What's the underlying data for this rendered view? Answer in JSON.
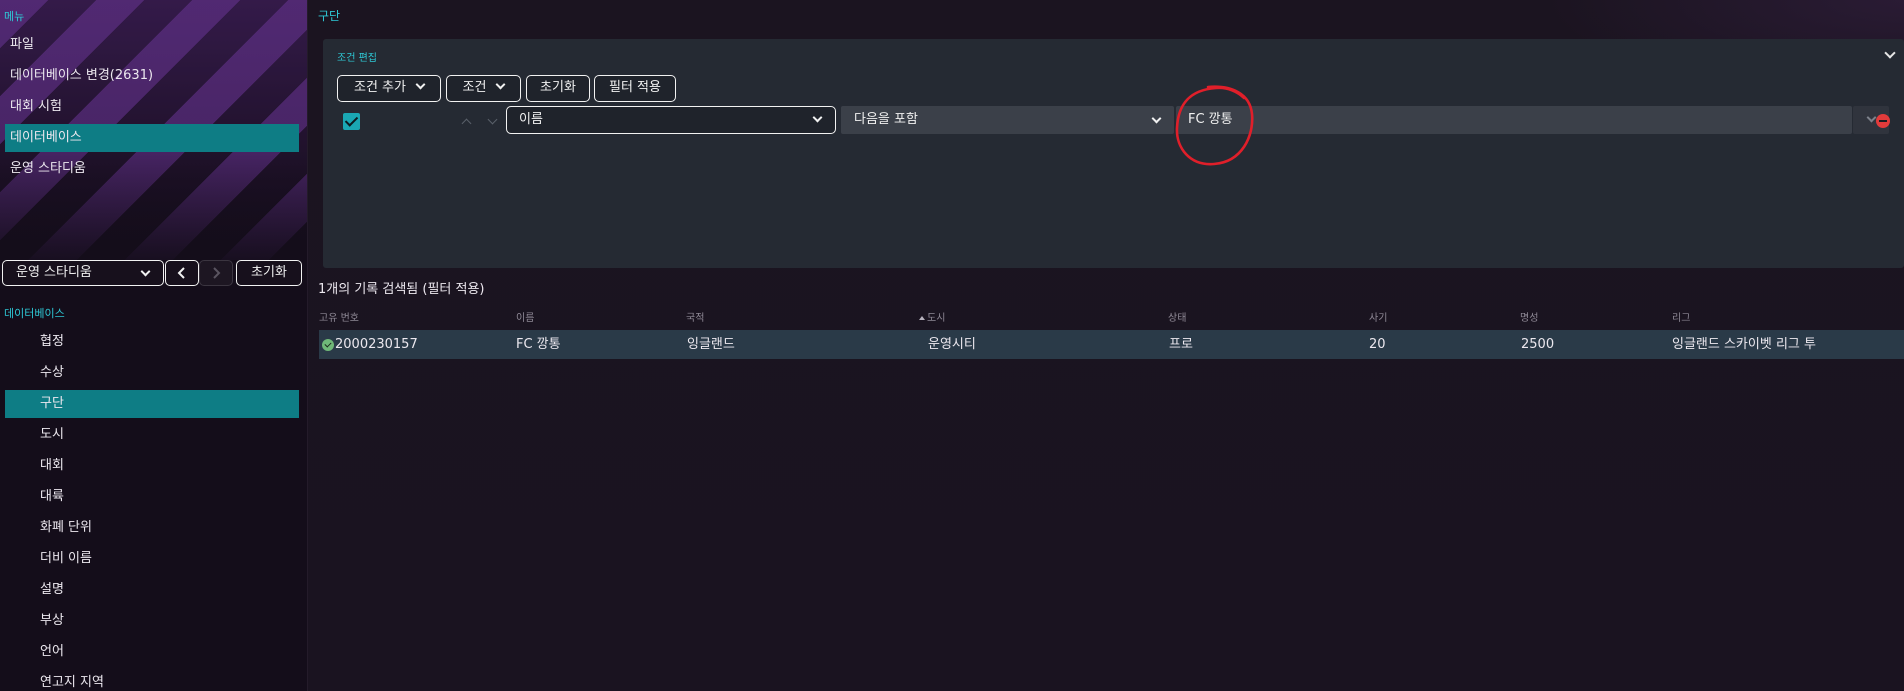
{
  "sidebar": {
    "menu_label": "메뉴",
    "menu_items": [
      {
        "label": "파일"
      },
      {
        "label": "데이터베이스 변경(2631)"
      },
      {
        "label": "대회 시험"
      },
      {
        "label": "데이터베이스",
        "active": true
      },
      {
        "label": "운영 스타디움"
      }
    ],
    "stadium_select": {
      "value": "운영 스타디움"
    },
    "reset_label": "초기화",
    "db_label": "데이터베이스",
    "db_items": [
      {
        "label": "협정"
      },
      {
        "label": "수상"
      },
      {
        "label": "구단",
        "active": true
      },
      {
        "label": "도시"
      },
      {
        "label": "대회"
      },
      {
        "label": "대륙"
      },
      {
        "label": "화폐 단위"
      },
      {
        "label": "더비 이름"
      },
      {
        "label": "설명"
      },
      {
        "label": "부상"
      },
      {
        "label": "언어"
      },
      {
        "label": "연고지 지역"
      }
    ]
  },
  "main": {
    "title": "구단",
    "filter_panel": {
      "title": "조건 편집",
      "add_condition_label": "조건 추가",
      "condition_label": "조건",
      "reset_label": "초기화",
      "apply_filter_label": "필터 적용",
      "condition_row": {
        "checked": true,
        "field": "이름",
        "operator": "다음을 포함",
        "value": "FC 깡통"
      }
    },
    "results": {
      "count_text": "1개의 기록 검색됨 (필터 적용)",
      "columns": [
        "고유 번호",
        "이름",
        "국적",
        "도시",
        "상태",
        "사기",
        "명성",
        "리그"
      ],
      "sorted_column": "도시",
      "rows": [
        {
          "id": "2000230157",
          "name": "FC 깡통",
          "nationality": "잉글랜드",
          "city": "운영시티",
          "status": "프로",
          "morale": "20",
          "reputation": "2500",
          "league": "잉글랜드 스카이벳 리그 투"
        }
      ]
    }
  },
  "colors": {
    "accent": "#2ec9d6",
    "selected": "#0e7d85",
    "annotation": "#e01f2a",
    "remove": "#e23b3b"
  }
}
